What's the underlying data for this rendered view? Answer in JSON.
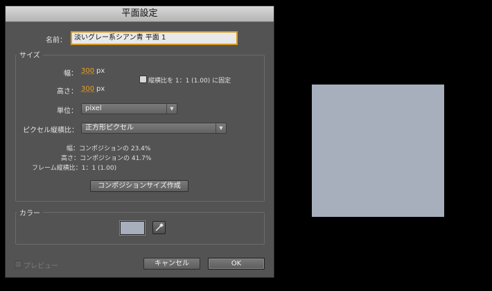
{
  "window": {
    "title": "平面設定"
  },
  "name": {
    "label": "名前：",
    "value": "淡いグレー系シアン青 平面 1"
  },
  "size_group": {
    "title": "サイズ",
    "width_label": "幅：",
    "width_value": "300",
    "width_unit": "px",
    "height_label": "高さ：",
    "height_value": "300",
    "height_unit": "px",
    "lock_aspect_label": "縦横比を 1：1 (1.00) に固定",
    "lock_aspect_checked": false,
    "units_label": "単位：",
    "units_value": "pixel",
    "pixel_aspect_label": "ピクセル縦横比：",
    "pixel_aspect_value": "正方形ピクセル",
    "info_width": "幅：コンポジションの 23.4%",
    "info_height": "高さ：コンポジションの 41.7%",
    "info_frame_aspect": "フレーム縦横比：1：1 (1.00)",
    "make_comp_size_button": "コンポジションサイズ作成"
  },
  "color_group": {
    "title": "カラー",
    "swatch_color": "#a7afbd"
  },
  "preview": {
    "label": "プレビュー",
    "checked": false
  },
  "buttons": {
    "cancel": "キャンセル",
    "ok": "OK"
  },
  "preview_canvas": {
    "color": "#a7afbd"
  }
}
